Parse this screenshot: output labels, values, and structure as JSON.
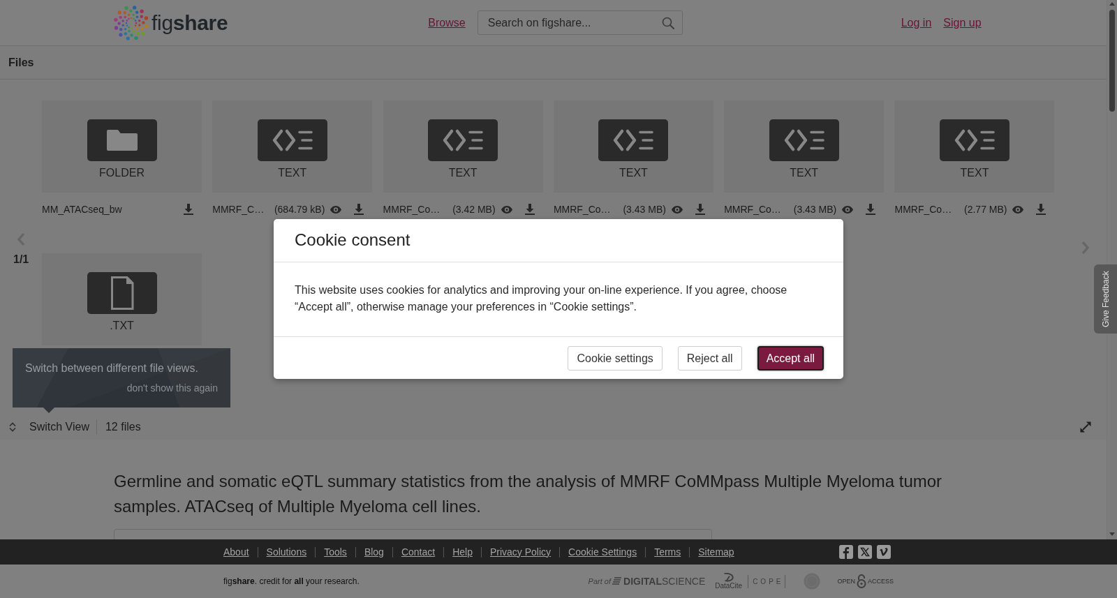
{
  "header": {
    "logo": "fig**share**",
    "nav_link": "Browse",
    "search": {
      "placeholder": "Search on figshare..."
    },
    "account_links": [
      "Log in",
      "Sign up"
    ]
  },
  "files_section": {
    "title": "Files",
    "pager": "1/1",
    "files": [
      {
        "kind": "folder",
        "type_label": "FOLDER",
        "name": "MM_ATACseq_bw",
        "preview": false
      },
      {
        "kind": "code",
        "type_label": "TEXT",
        "name": "MMRF_C…",
        "size": "(684.79 kB)",
        "preview": true
      },
      {
        "kind": "code",
        "type_label": "TEXT",
        "name": "MMRF_Co…",
        "size": "(3.42 MB)",
        "preview": true
      },
      {
        "kind": "code",
        "type_label": "TEXT",
        "name": "MMRF_Co…",
        "size": "(3.43 MB)",
        "preview": true
      },
      {
        "kind": "code",
        "type_label": "TEXT",
        "name": "MMRF_Co…",
        "size": "(3.43 MB)",
        "preview": true
      },
      {
        "kind": "code",
        "type_label": "TEXT",
        "name": "MMRF_Co…",
        "size": "(2.77 MB)",
        "preview": true
      },
      {
        "kind": "document",
        "type_label": ".TXT"
      }
    ],
    "tooltip": {
      "text": "Switch between different file views.",
      "dismiss": "don't show this again"
    },
    "toolbar": {
      "switch_view": "Switch View",
      "file_count": "12 files"
    }
  },
  "article": {
    "title": "Germline and somatic eQTL summary statistics from the analysis of MMRF CoMMpass Multiple Myeloma tumor samples. ATACseq of Multiple Myeloma cell lines."
  },
  "feedback_tab": {
    "label": "Give Feedback"
  },
  "cookie_dialog": {
    "title": "Cookie consent",
    "message": "This website uses cookies for analytics and improving your on-line experience. If you agree, choose “Accept all”, otherwise manage your preferences in “Cookie settings”.",
    "buttons": [
      {
        "label": "Cookie settings",
        "kind": "secondary"
      },
      {
        "label": "Reject all",
        "kind": "secondary"
      },
      {
        "label": "Accept all",
        "kind": "primary"
      }
    ]
  },
  "footer": {
    "links": [
      "About",
      "Solutions",
      "Tools",
      "Blog",
      "Contact",
      "Help",
      "Privacy Policy",
      "Cookie Settings",
      "Terms",
      "Sitemap"
    ],
    "social": [
      {
        "kind": "facebook"
      },
      {
        "kind": "x"
      },
      {
        "kind": "vimeo"
      }
    ],
    "tagline": "fig**share**. credit for **all** your research.",
    "partners": [
      {
        "kind": "digital_science",
        "prefix": "Part of",
        "name": "**DIGITAL**SCIENCE"
      },
      {
        "kind": "datacite",
        "name": "DataCite"
      },
      {
        "kind": "cope",
        "name": "COPE"
      },
      {
        "kind": "seal"
      },
      {
        "kind": "open_access",
        "left": "OPEN",
        "right": "ACCESS"
      }
    ]
  }
}
